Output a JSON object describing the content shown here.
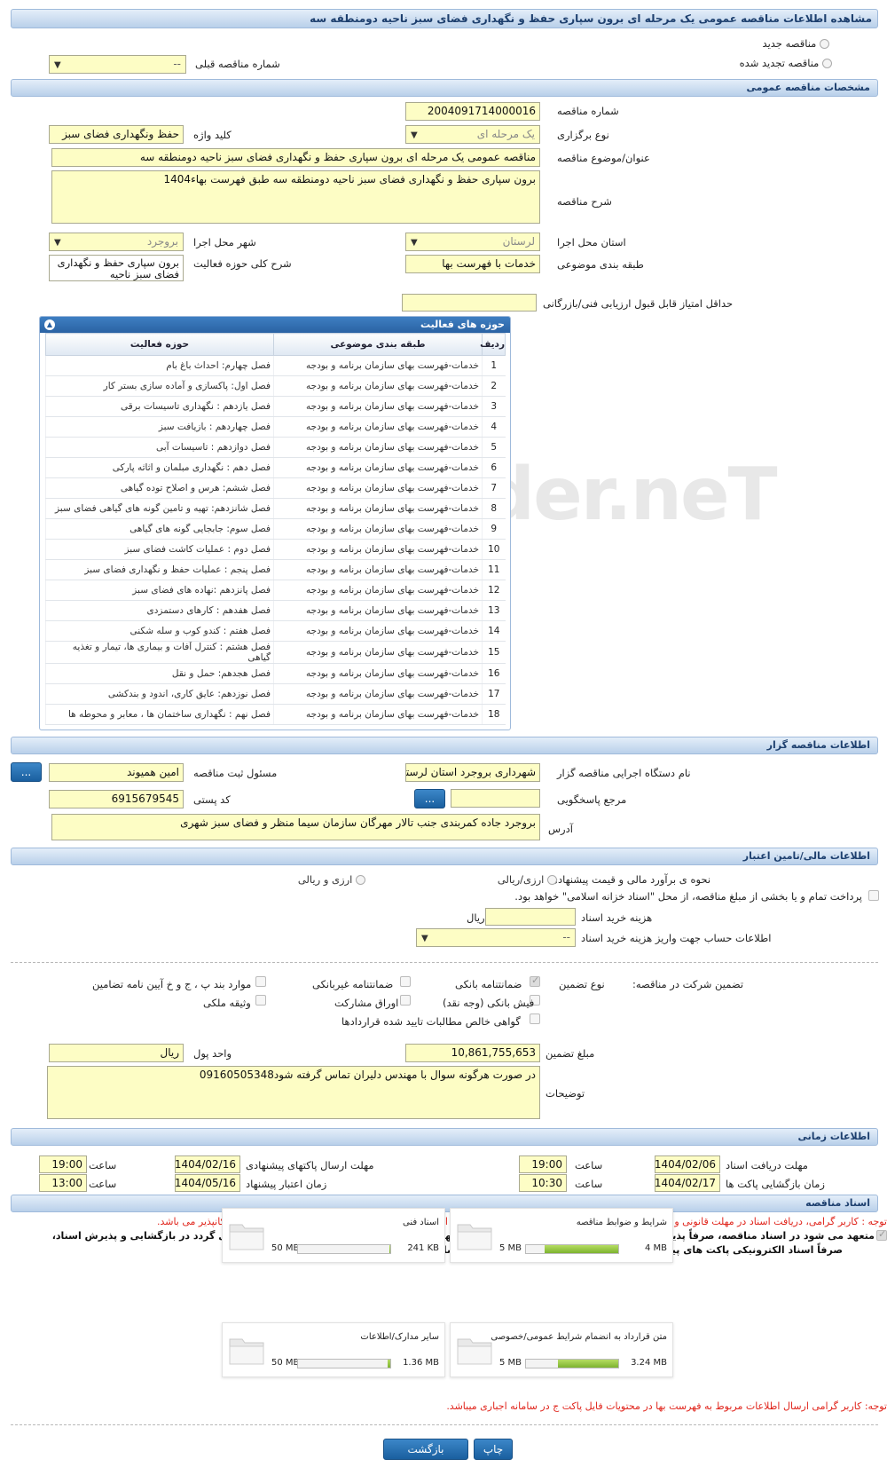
{
  "page_title": "مشاهده اطلاعات مناقصه عمومی یک مرحله ای برون سپاری حفظ و نگهداری فضای سبز ناحیه دومنطقه سه",
  "tender_type": {
    "new_label": "مناقصه جدید",
    "renewed_label": "مناقصه تجدید شده",
    "prev_number_label": "شماره مناقصه قبلی",
    "prev_number_value": "--"
  },
  "sections": {
    "general": "مشخصات مناقصه عمومی",
    "organizer": "اطلاعات مناقصه گزار",
    "financial": "اطلاعات مالی/تامین اعتبار",
    "timing": "اطلاعات زمانی",
    "documents": "اسناد مناقصه"
  },
  "general": {
    "number_label": "شماره مناقصه",
    "number_value": "2004091714000016",
    "holding_type_label": "نوع برگزاری",
    "holding_type_value": "یک مرحله ای",
    "keyword_label": "کلید واژه",
    "keyword_value": "حفظ ونگهداری فضای سبز",
    "subject_label": "عنوان/موضوع مناقصه",
    "subject_value": "مناقصه عمومی یک مرحله ای برون سپاری حفظ و نگهداری فضای سبز  ناحیه دومنطقه سه",
    "description_label": "شرح مناقصه",
    "description_value": "برون سپاری حفظ و نگهداری فضای سبز  ناحیه دومنطقه سه طبق فهرست بهاء1404",
    "province_label": "استان محل اجرا",
    "province_value": "لرستان",
    "city_label": "شهر محل اجرا",
    "city_value": "بروجرد",
    "category_label": "طبقه بندی موضوعی",
    "category_value": "خدمات با فهرست بها",
    "activity_desc_label": "شرح کلی حوزه فعالیت",
    "activity_desc_value": "برون سپاری حفظ و نگهداری فضای سبز  ناحیه",
    "min_score_label": "حداقل امتیاز قابل قبول ارزیابی فنی/بازرگانی",
    "min_score_value": ""
  },
  "activities_panel": {
    "title": "حوزه های فعالیت",
    "columns": [
      "ردیف",
      "طبقه بندی موضوعی",
      "حوزه فعالیت"
    ],
    "rows": [
      [
        "1",
        "خدمات-فهرست بهای سازمان برنامه و بودجه",
        "فصل چهارم: احداث باغ بام"
      ],
      [
        "2",
        "خدمات-فهرست بهای سازمان برنامه و بودجه",
        "فصل اول:  پاکسازی و آماده سازی بستر کار"
      ],
      [
        "3",
        "خدمات-فهرست بهای سازمان برنامه و بودجه",
        "فصل یازدهم : نگهداری تاسیسات برقی"
      ],
      [
        "4",
        "خدمات-فهرست بهای سازمان برنامه و بودجه",
        "فصل چهاردهم : بازیافت سبز"
      ],
      [
        "5",
        "خدمات-فهرست بهای سازمان برنامه و بودجه",
        "فصل دوازدهم : تاسیسات آبی"
      ],
      [
        "6",
        "خدمات-فهرست بهای سازمان برنامه و بودجه",
        "فصل دهم : نگهداری مبلمان و اثاثه پارکی"
      ],
      [
        "7",
        "خدمات-فهرست بهای سازمان برنامه و بودجه",
        "فصل ششم: هرس و اصلاح توده گیاهی"
      ],
      [
        "8",
        "خدمات-فهرست بهای سازمان برنامه و بودجه",
        "فصل شانزدهم: تهیه و تامین گونه های گیاهی فضای سبز"
      ],
      [
        "9",
        "خدمات-فهرست بهای سازمان برنامه و بودجه",
        "فصل سوم: جابجایی گونه های گیاهی"
      ],
      [
        "10",
        "خدمات-فهرست بهای سازمان برنامه و بودجه",
        "فصل دوم : عملیات کاشت فضای سبز"
      ],
      [
        "11",
        "خدمات-فهرست بهای سازمان برنامه و بودجه",
        "فصل پنجم : عملیات حفظ و نگهداری فضای سبز"
      ],
      [
        "12",
        "خدمات-فهرست بهای سازمان برنامه و بودجه",
        "فصل پانزدهم :نهاده های فضای سبز"
      ],
      [
        "13",
        "خدمات-فهرست بهای سازمان برنامه و بودجه",
        "فصل هفدهم : کارهای دستمزدی"
      ],
      [
        "14",
        "خدمات-فهرست بهای سازمان برنامه و بودجه",
        "فصل هفتم : کندو کوب و سله شکنی"
      ],
      [
        "15",
        "خدمات-فهرست بهای سازمان برنامه و بودجه",
        "فصل هشتم : کنترل آفات و بیماری ها، تیمار و تغذیه گیاهی"
      ],
      [
        "16",
        "خدمات-فهرست بهای سازمان برنامه و بودجه",
        "فصل هجدهم: حمل و نقل"
      ],
      [
        "17",
        "خدمات-فهرست بهای سازمان برنامه و بودجه",
        "فصل نوزدهم: عایق کاری، اندود و بندکشی"
      ],
      [
        "18",
        "خدمات-فهرست بهای سازمان برنامه و بودجه",
        "فصل نهم : نگهداری ساختمان ها ، معابر و محوطه ها"
      ]
    ]
  },
  "organizer": {
    "executor_label": "نام دستگاه اجرایی مناقصه گزار",
    "executor_value": "شهرداری بروجرد استان لرستان",
    "registrar_label": "مسئول ثبت مناقصه",
    "registrar_value": "امین همیوند",
    "reference_label": "مرجع پاسخگویی",
    "reference_value": "",
    "postal_label": "کد پستی",
    "postal_value": "6915679545",
    "address_label": "آدرس",
    "address_value": "بروجرد جاده کمربندی جنب تالار مهرگان سازمان سیما منظر و فضای سبز شهری",
    "lookup_button": "..."
  },
  "financial": {
    "estimate_label": "نحوه ی برآورد مالی و قیمت پیشنهادی",
    "opt_currency_rial": "ارزی/ریالی",
    "opt_currency_and_rial": "ارزی و ریالی",
    "treasury_text": "پرداخت تمام و یا بخشی از مبلغ مناقصه، از محل \"اسناد خزانه اسلامی\" خواهد بود.",
    "doc_cost_label": "هزینه خرید اسناد",
    "doc_cost_value": "",
    "doc_cost_unit": "ریال",
    "account_label": "اطلاعات حساب جهت واریز هزینه خرید اسناد",
    "account_value": "--",
    "guarantee_participation_label": "تضمین شرکت در مناقصه:",
    "guarantee_type_label": "نوع تضمین",
    "guarantee_options": {
      "bank_guarantee": "ضمانتنامه بانکی",
      "non_bank_guarantee": "ضمانتنامه غیربانکی",
      "bylaw_items": "موارد بند پ ، ج و خ آیین نامه تضامین",
      "bank_receipt": "فیش بانکی (وجه نقد)",
      "securities": "اوراق مشارکت",
      "property_deposit": "وثیقه ملکی",
      "receivables_cert": "گواهی خالص مطالبات تایید شده قراردادها"
    },
    "guarantee_amount_label": "مبلغ تضمین",
    "guarantee_amount_value": "10,861,755,653",
    "currency_label": "واحد پول",
    "currency_value": "ریال",
    "notes_label": "توضیحات",
    "notes_value": "در صورت هرگونه سوال با مهندس دلیران تماس گرفته شود09160505348"
  },
  "timing": {
    "doc_deadline_label": "مهلت دریافت اسناد",
    "doc_deadline_date": "1404/02/06",
    "doc_deadline_time": "19:00",
    "send_deadline_label": "مهلت ارسال پاکتهای پیشنهادی",
    "send_deadline_date": "1404/02/16",
    "send_deadline_time": "19:00",
    "opening_label": "زمان بازگشایی پاکت ها",
    "opening_date": "1404/02/17",
    "opening_time": "10:30",
    "validity_label": "زمان اعتبار پیشنهاد",
    "validity_date": "1404/05/16",
    "validity_time": "13:00",
    "time_label": "ساعت"
  },
  "documents": {
    "note1": "توجه : کاربر گرامی، دریافت اسناد در مهلت قانونی و پس از افزودن فراخوان به کارتابل \"فراخوان های من\"، از طریق ستون \"دانلود اسناد\" موجود در این کارتابل، امکانپذیر می باشد.",
    "commit1": "متعهد می شود در اسناد مناقصه، صرفاً پذیرش اسناد الکترونیکی پاکت های (ب) و (ج) مجهز به امضای الکترونیکی قید شده باشد. تعهد می گردد در بازگشایی و پذیرش اسناد،",
    "commit2": "صرفاً اسناد الکترونیکی پاکت های پیشنهاد (ب) و (ج) مجهز به امضای الکترونیکی صاحبان امضای مجاز مورد پذیرش واقع گردد.",
    "files": [
      {
        "name": "شرایط و ضوابط مناقصه",
        "current": "4 MB",
        "max": "5 MB",
        "fill": 0.8
      },
      {
        "name": "اسناد فنی",
        "current": "241 KB",
        "max": "50 MB",
        "fill": 0.005
      },
      {
        "name": "متن قرارداد به انضمام شرایط عمومی/خصوصی",
        "current": "3.24 MB",
        "max": "5 MB",
        "fill": 0.65
      },
      {
        "name": "سایر مدارک/اطلاعات",
        "current": "1.36 MB",
        "max": "50 MB",
        "fill": 0.03
      }
    ],
    "note2": "توجه: کاربر گرامی ارسال اطلاعات مربوط به فهرست بها در محتویات فایل پاکت ج در سامانه اجباری میباشد."
  },
  "footer": {
    "print_button": "چاپ",
    "back_button": "بازگشت"
  },
  "watermark": "AriaTender.neT"
}
